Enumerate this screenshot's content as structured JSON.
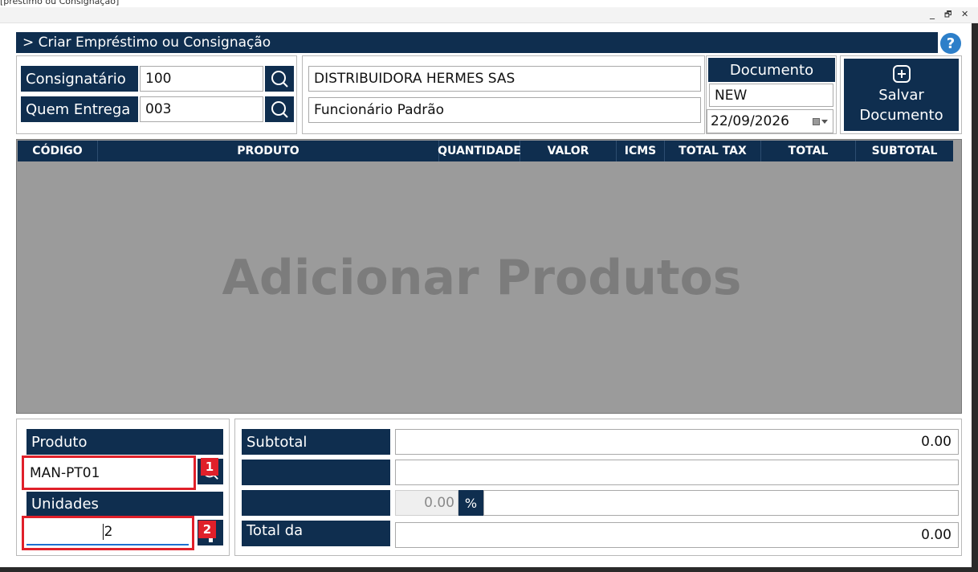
{
  "window": {
    "title": "[préstimo ou Consignação]",
    "minimize_glyph": "_",
    "restore_glyph": "🗗",
    "close_glyph": "✕"
  },
  "header": {
    "title": "> Criar Empréstimo ou Consignação",
    "help_glyph": "?"
  },
  "consignee": {
    "consignatario_label": "Consignatário",
    "consignatario_value": "100",
    "quem_entrega_label": "Quem Entrega",
    "quem_entrega_value": "003",
    "consignatario_name": "DISTRIBUIDORA HERMES SAS",
    "quem_entrega_name": "Funcionário Padrão"
  },
  "document": {
    "label": "Documento",
    "status": "NEW",
    "date": "22/09/2026"
  },
  "save_button": {
    "label_line1": "Salvar",
    "label_line2": "Documento"
  },
  "grid": {
    "columns": [
      "CÓDIGO",
      "PRODUTO",
      "QUANTIDADE",
      "VALOR",
      "ICMS",
      "TOTAL TAX",
      "TOTAL",
      "SUBTOTAL"
    ],
    "placeholder": "Adicionar Produtos"
  },
  "product_entry": {
    "produto_label": "Produto",
    "produto_value": "MAN-PT01",
    "unidades_label": "Unidades",
    "unidades_value": "2",
    "badge_1": "1",
    "badge_2": "2"
  },
  "totals": {
    "subtotal_label": "Subtotal",
    "subtotal_value": "0.00",
    "row2_label": "",
    "row2_value": "",
    "discount_label": "",
    "discount_value": "0.00",
    "percent_symbol": "%",
    "total_label": "Total da",
    "total_value": "0.00"
  }
}
